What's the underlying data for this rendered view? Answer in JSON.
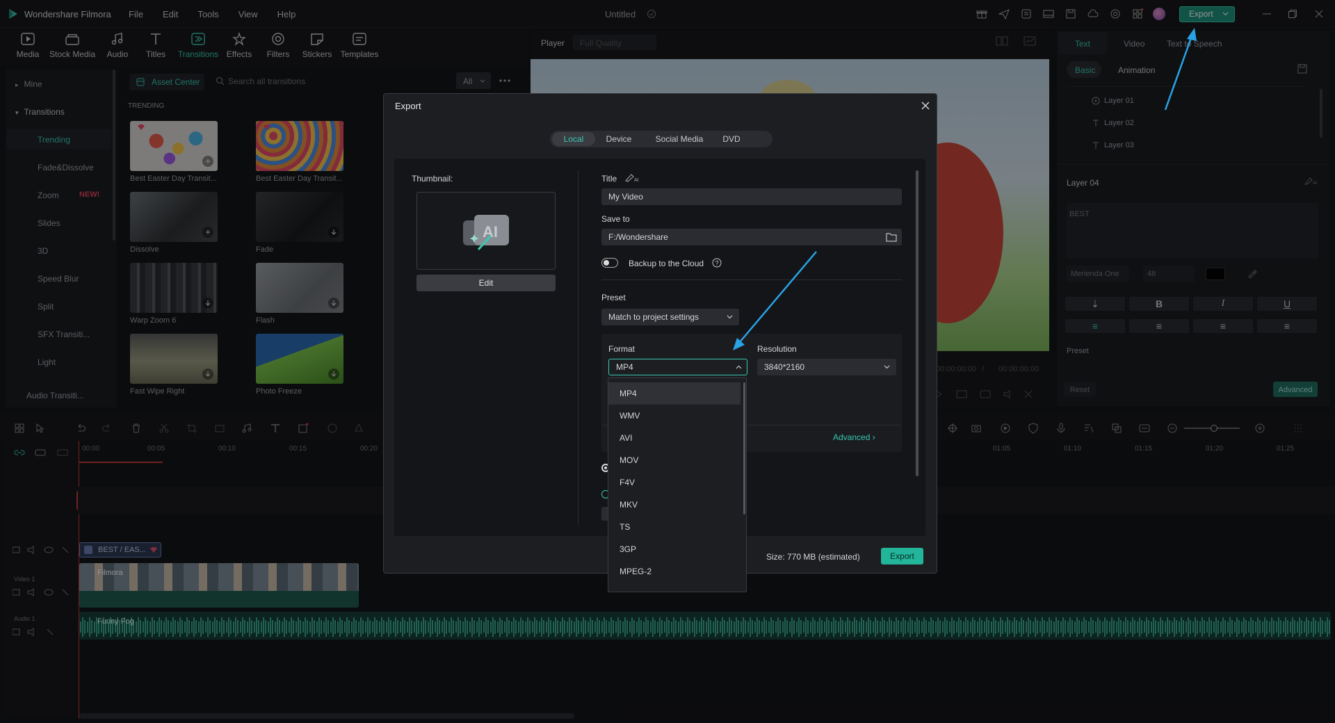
{
  "app": {
    "name": "Wondershare Filmora",
    "project_title": "Untitled",
    "export_label": "Export"
  },
  "menu": [
    "File",
    "Edit",
    "Tools",
    "View",
    "Help"
  ],
  "toolbar": [
    {
      "label": "Media",
      "icon": "media-icon"
    },
    {
      "label": "Stock Media",
      "icon": "stock-media-icon"
    },
    {
      "label": "Audio",
      "icon": "audio-icon"
    },
    {
      "label": "Titles",
      "icon": "titles-icon"
    },
    {
      "label": "Transitions",
      "icon": "transitions-icon",
      "active": true
    },
    {
      "label": "Effects",
      "icon": "effects-icon"
    },
    {
      "label": "Filters",
      "icon": "filters-icon"
    },
    {
      "label": "Stickers",
      "icon": "stickers-icon"
    },
    {
      "label": "Templates",
      "icon": "templates-icon"
    }
  ],
  "left_panel": {
    "mine": "Mine",
    "transitions": "Transitions",
    "items": [
      "Trending",
      "Fade&Dissolve",
      "Zoom",
      "Slides",
      "3D",
      "Speed Blur",
      "Split",
      "SFX Transiti...",
      "Light",
      "Audio Transiti..."
    ],
    "zoom_badge": "NEW!",
    "asset_center": "Asset Center",
    "search_placeholder": "Search all transitions",
    "filter_all": "All",
    "section": "TRENDING",
    "thumbs": [
      "Best Easter Day Transit...",
      "Best Easter Day Transit...",
      "Dissolve",
      "Fade",
      "Warp Zoom 6",
      "Flash",
      "Fast Wipe Right",
      "Photo Freeze"
    ]
  },
  "player": {
    "label": "Player",
    "quality": "Full Quality",
    "time_current": "00:00:00:00",
    "time_sep": "/",
    "time_total": "00:00:00:00"
  },
  "right_panel": {
    "tabs": [
      "Text",
      "Video",
      "Text to Speech"
    ],
    "subtabs": [
      "Basic",
      "Animation"
    ],
    "layers": [
      "Layer 01",
      "Layer 02",
      "Layer 03"
    ],
    "layer_title": "Layer 04",
    "text_content": "BEST",
    "font": "Merienda One",
    "font_size": "48",
    "preset": "Preset",
    "reset": "Reset",
    "advanced": "Advanced"
  },
  "timeline": {
    "ruler": [
      "00:00",
      "00:05",
      "00:10",
      "00:15",
      "00:20"
    ],
    "ruler_right": [
      "01:05",
      "01:10",
      "01:15",
      "01:20",
      "01:25"
    ],
    "title_clip": "BEST / EAS...",
    "video_clip": "Filmora",
    "video_track": "Video 1",
    "audio_track": "Audio 1",
    "audio_clip": "Funny Fog"
  },
  "dialog": {
    "title": "Export",
    "tabs": [
      "Local",
      "Device",
      "Social Media",
      "DVD"
    ],
    "thumbnail_label": "Thumbnail:",
    "edit": "Edit",
    "title_label": "Title",
    "title_value": "My Video",
    "save_to_label": "Save to",
    "save_to_value": "F:/Wondershare",
    "backup": "Backup to the Cloud",
    "preset_label": "Preset",
    "preset_value": "Match to project settings",
    "format_label": "Format",
    "format_value": "MP4",
    "resolution_label": "Resolution",
    "resolution_value": "3840*2160",
    "advanced": "Advanced",
    "format_options": [
      "MP4",
      "WMV",
      "AVI",
      "MOV",
      "F4V",
      "MKV",
      "TS",
      "3GP",
      "MPEG-2"
    ],
    "size_label": "Size:",
    "size_value": "770 MB (estimated)",
    "export_button": "Export"
  },
  "colors": {
    "accent": "#38c9b0",
    "arrow": "#2aa3e6",
    "export_green": "#1f8f7c"
  }
}
